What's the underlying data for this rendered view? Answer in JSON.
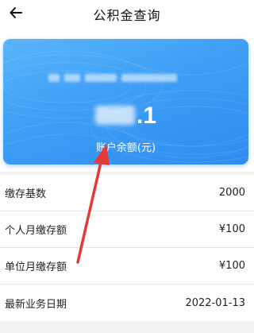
{
  "header": {
    "title": "公积金查询"
  },
  "card": {
    "amount_suffix": ".1",
    "amount_label": "账户余额(元)"
  },
  "rows": [
    {
      "label": "缴存基数",
      "value": "2000"
    },
    {
      "label": "个人月缴存额",
      "value": "¥100"
    },
    {
      "label": "单位月缴存额",
      "value": "¥100"
    },
    {
      "label": "最新业务日期",
      "value": "2022-01-13"
    }
  ],
  "colors": {
    "card_start": "#5ab5fb",
    "card_end": "#2f8cf0",
    "arrow": "#e53935"
  },
  "icons": {
    "back": "arrow-left-icon"
  }
}
